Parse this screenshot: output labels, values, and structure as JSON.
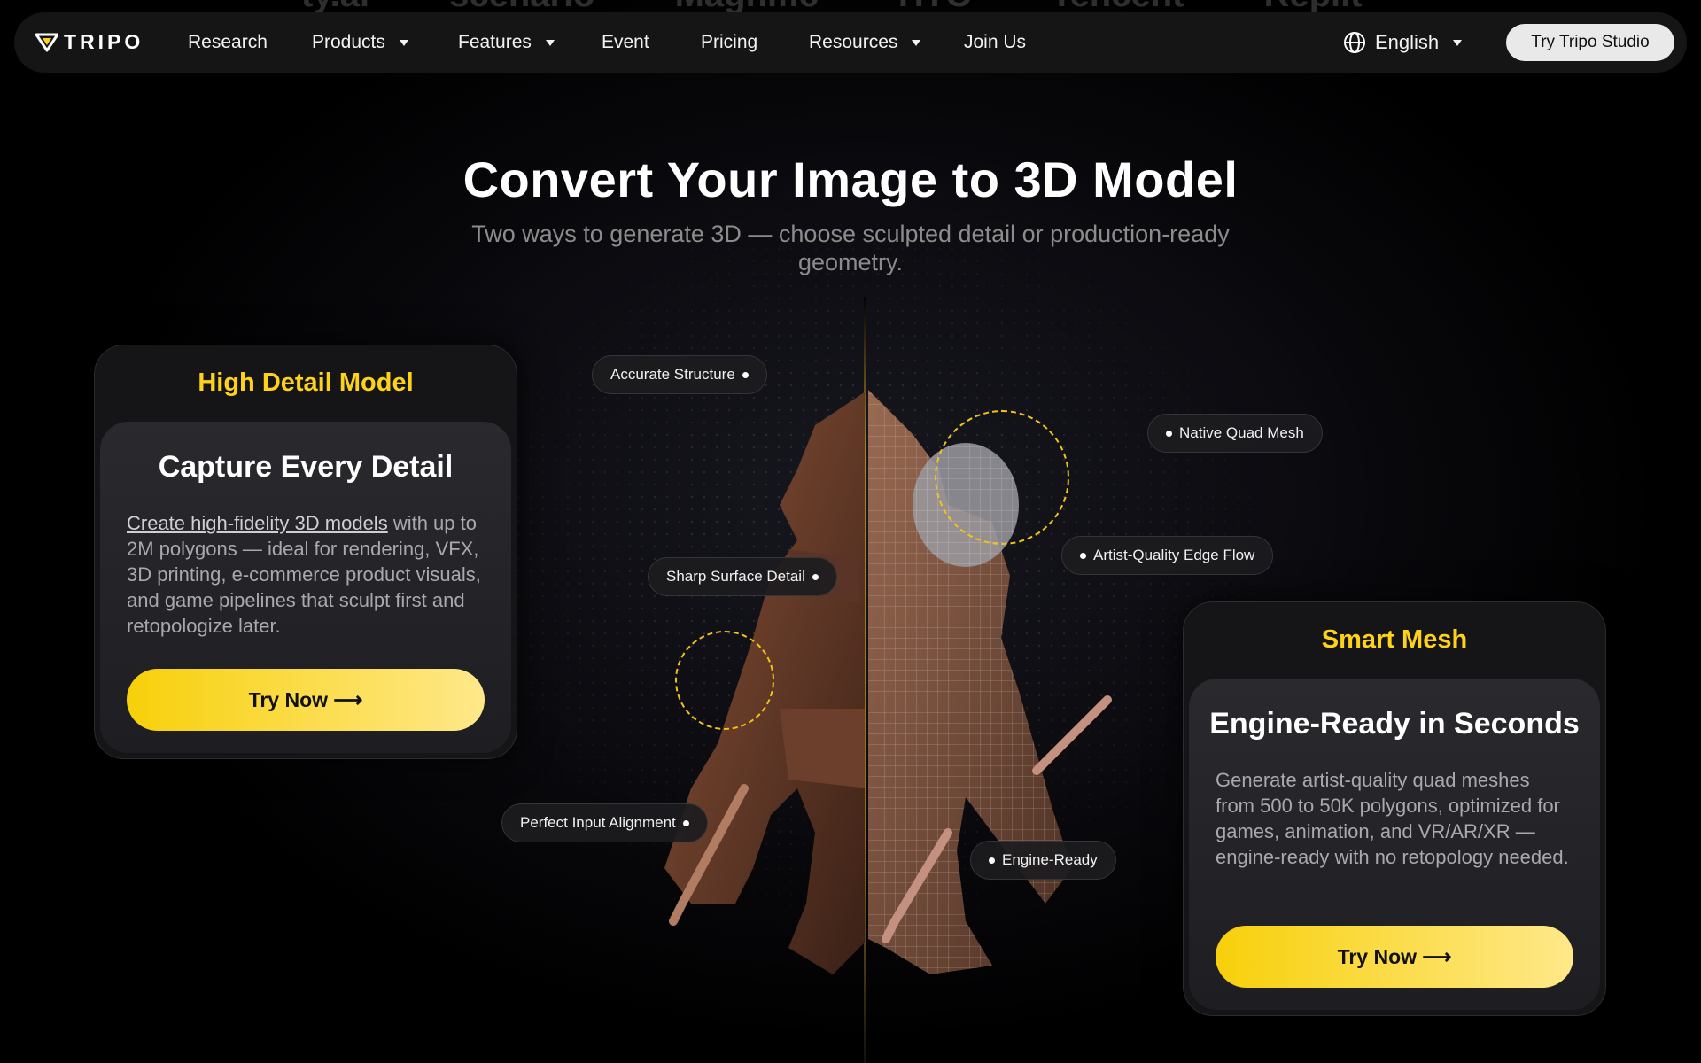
{
  "partner_logos": [
    "ty.ai",
    "scenario",
    "Magnific",
    "HTC",
    "Tencent",
    "Replit"
  ],
  "nav": {
    "brand": "TRIPO",
    "items": [
      {
        "label": "Research",
        "dropdown": false
      },
      {
        "label": "Products",
        "dropdown": true
      },
      {
        "label": "Features",
        "dropdown": true
      },
      {
        "label": "Event",
        "dropdown": false
      },
      {
        "label": "Pricing",
        "dropdown": false
      },
      {
        "label": "Resources",
        "dropdown": true
      },
      {
        "label": "Join Us",
        "dropdown": false
      }
    ],
    "language": "English",
    "cta": "Try Tripo Studio"
  },
  "hero": {
    "title": "Convert Your Image to 3D Model",
    "subtitle": "Two ways to generate 3D — choose sculpted detail or production-ready geometry."
  },
  "left_card": {
    "heading": "High Detail Model",
    "title": "Capture Every Detail",
    "link_text": "Create high-fidelity 3D models",
    "body_rest": " with up to 2M polygons — ideal for rendering, VFX, 3D printing, e-commerce product visuals, and game pipelines that sculpt first and retopologize later.",
    "button": "Try Now ⟶"
  },
  "right_card": {
    "heading": "Smart Mesh",
    "title": "Engine-Ready in Seconds",
    "body": "Generate artist-quality quad meshes from 500 to 50K polygons, optimized for games, animation, and VR/AR/XR — engine-ready with no retopology needed.",
    "button": "Try Now ⟶"
  },
  "features": {
    "accurate_structure": "Accurate Structure",
    "sharp_surface": "Sharp Surface Detail",
    "perfect_alignment": "Perfect Input Alignment",
    "native_quad": "Native Quad Mesh",
    "edge_flow": "Artist-Quality Edge Flow",
    "engine_ready": "Engine-Ready"
  },
  "colors": {
    "accent_yellow": "#ffd21a",
    "background": "#000000",
    "nav_bg": "#151515"
  },
  "icons": [
    "tripo-logo-icon",
    "caret-down-icon",
    "globe-icon",
    "arrow-right-icon"
  ]
}
